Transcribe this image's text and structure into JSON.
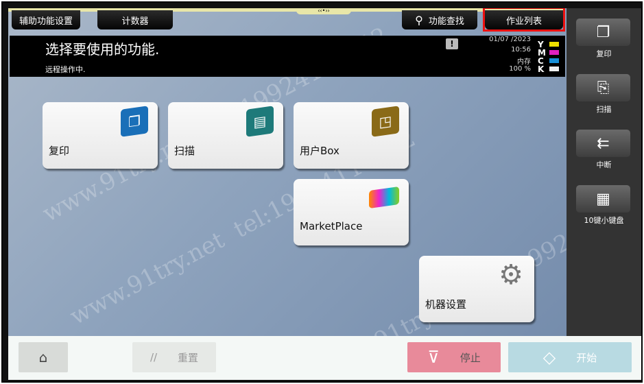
{
  "top_buttons": {
    "accessibility": "辅助功能设置",
    "counter": "计数器",
    "function_search": "功能查找",
    "job_list": "作业列表"
  },
  "header": {
    "title": "选择要使用的功能.",
    "subtitle": "远程操作中.",
    "date": "01/07 /2023",
    "time": "10:56",
    "memory_label": "内存",
    "memory_value": "100 %",
    "toners": [
      {
        "letter": "Y",
        "color": "#f0e000"
      },
      {
        "letter": "M",
        "color": "#e020c0"
      },
      {
        "letter": "C",
        "color": "#1890d8"
      },
      {
        "letter": "K",
        "color": "#f0f0f0"
      }
    ]
  },
  "tiles": [
    {
      "label": "复印",
      "icon": "copy-icon",
      "color": "#1a6fb8"
    },
    {
      "label": "扫描",
      "icon": "scan-icon",
      "color": "#1e7a7a"
    },
    {
      "label": "用户Box",
      "icon": "box-icon",
      "color": "#8a6a18"
    },
    {
      "label": "MarketPlace",
      "icon": "marketplace-icon"
    },
    {
      "label": "机器设置",
      "icon": "gear-icon"
    }
  ],
  "sidebar": [
    {
      "label": "复印",
      "icon": "copy-icon"
    },
    {
      "label": "扫描",
      "icon": "scan-icon"
    },
    {
      "label": "中断",
      "icon": "interrupt-icon"
    },
    {
      "label": "10键小键盘",
      "icon": "keypad-icon"
    }
  ],
  "bottom": {
    "home_icon": "home-icon",
    "reset": "重置",
    "stop": "停止",
    "start": "开始",
    "stop_color": "#e88a9a",
    "start_color": "#b8dae2"
  },
  "watermark": "www.91try.net tel:19924114142"
}
